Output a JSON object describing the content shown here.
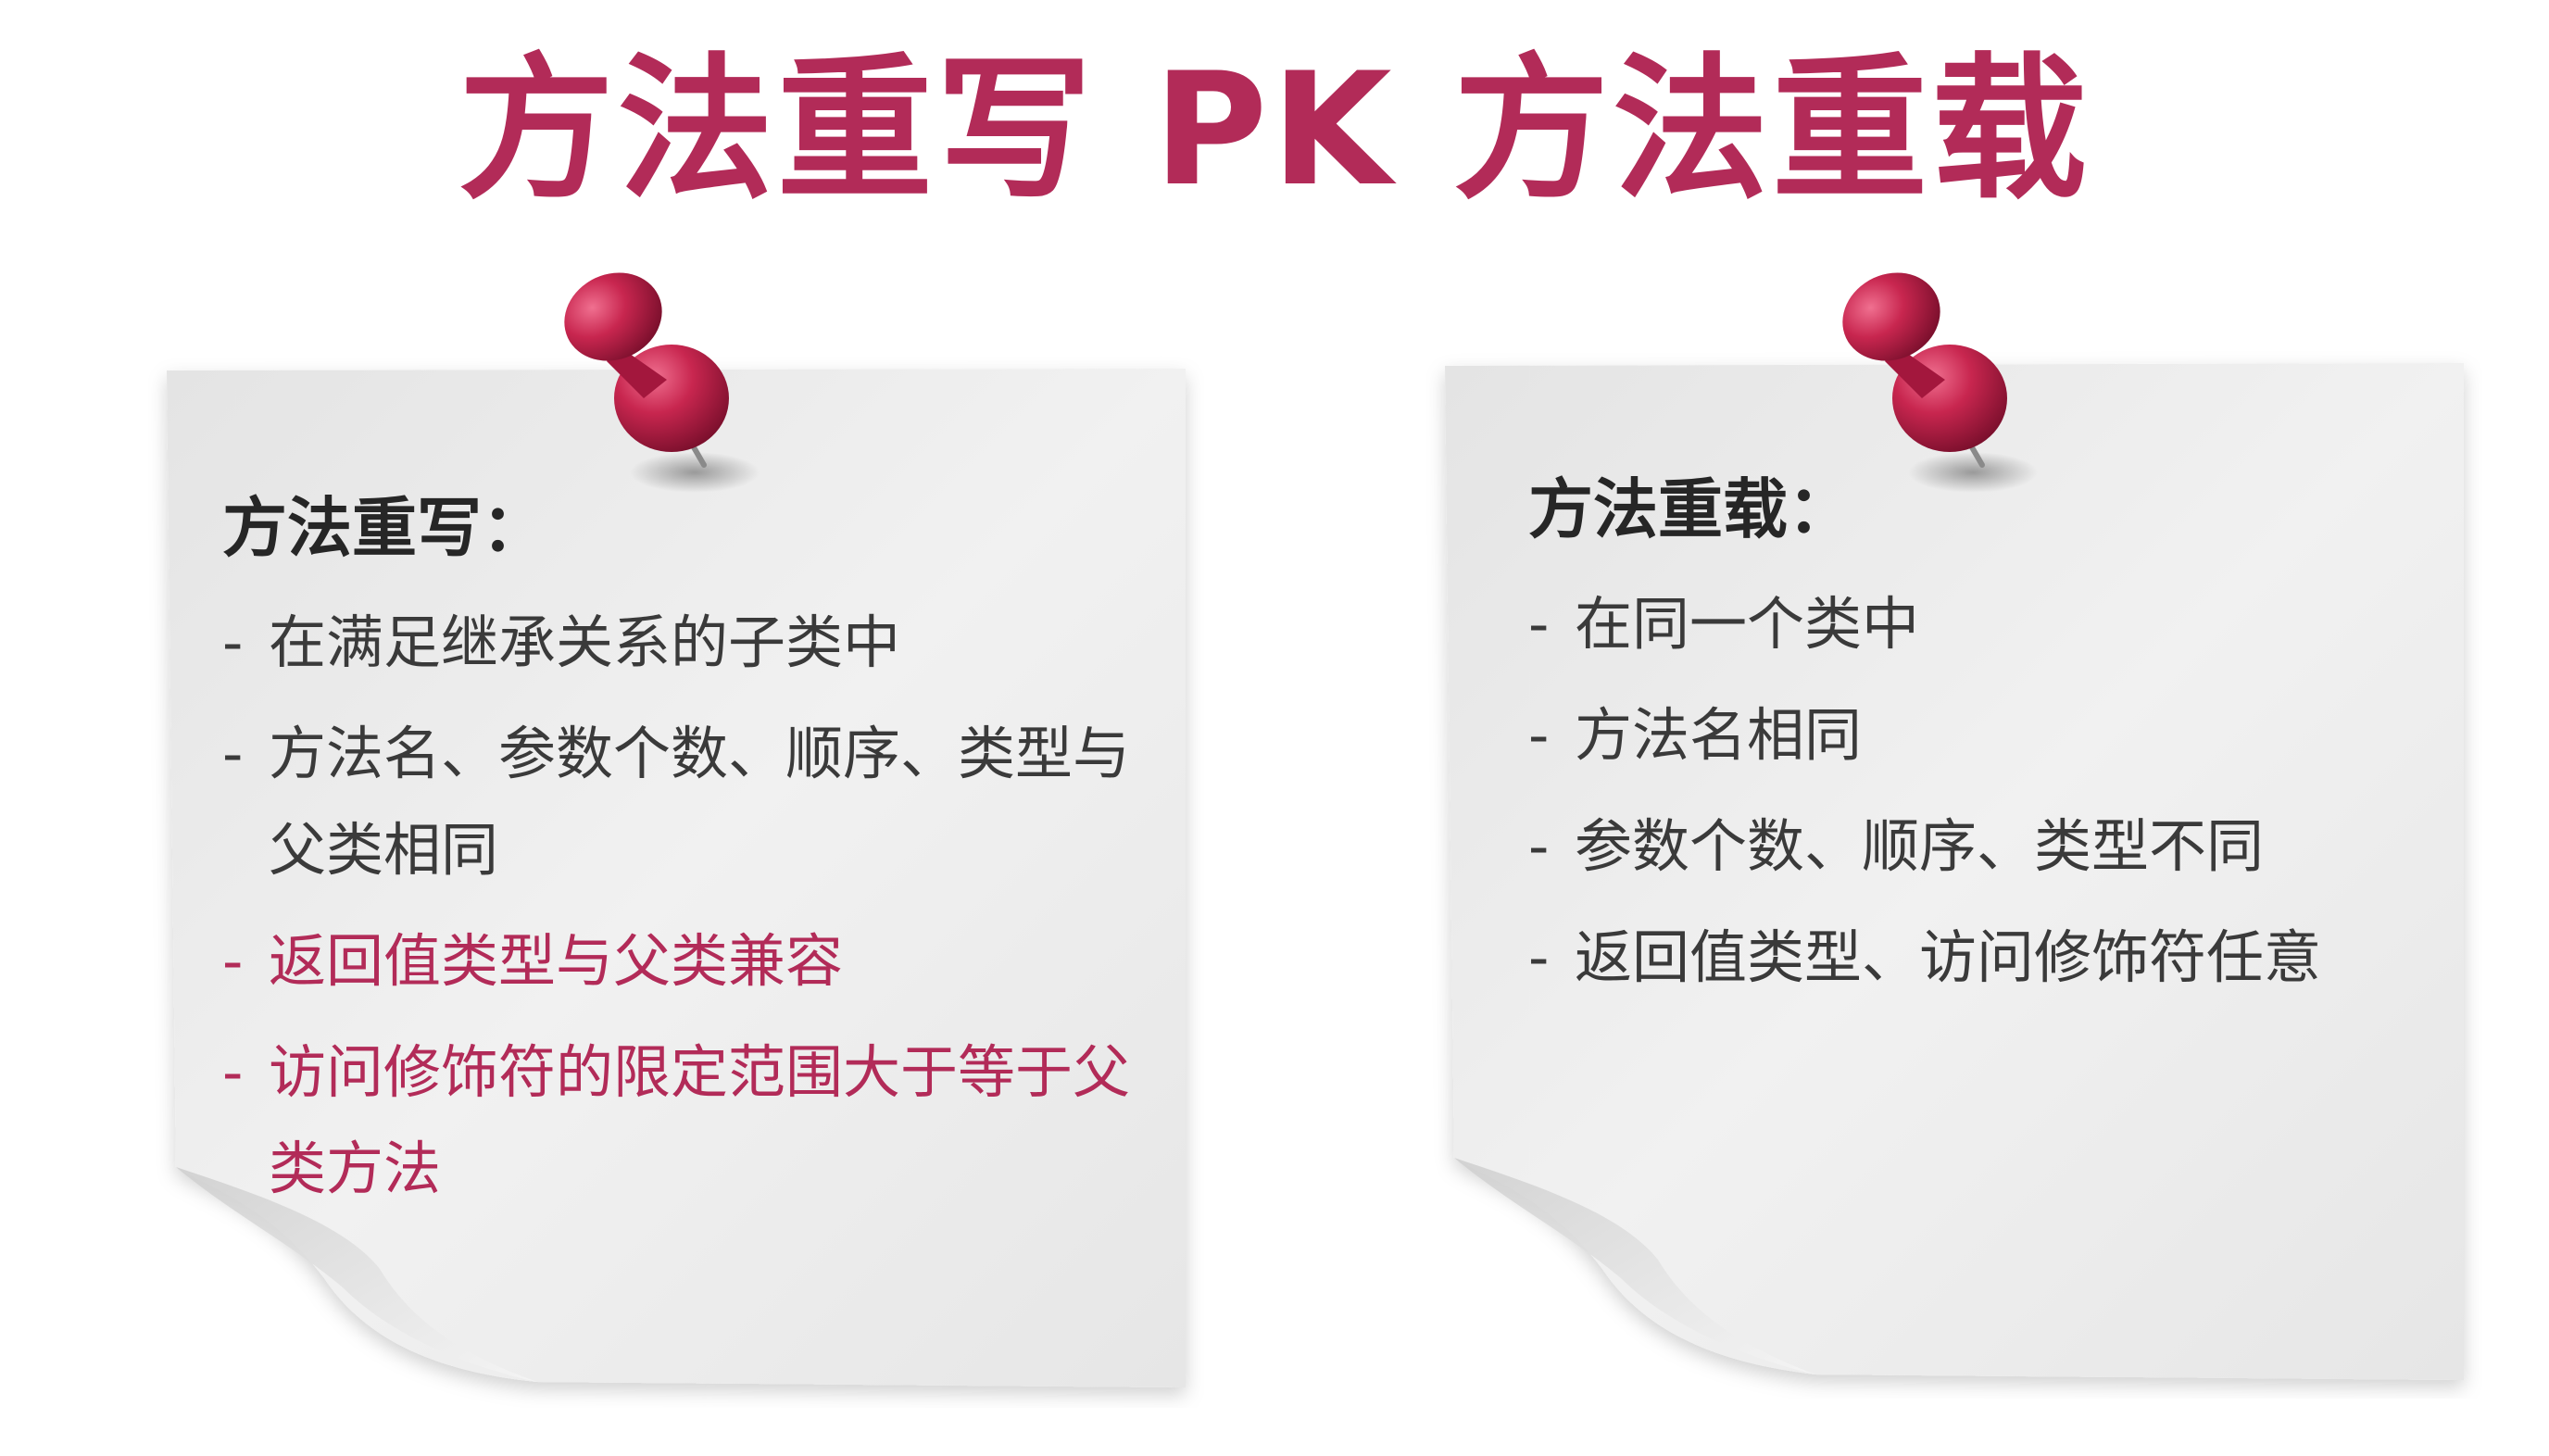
{
  "title": "方法重写   PK 方法重载",
  "accent_color": "#b22b58",
  "text_color": "#3a3a3a",
  "cards": [
    {
      "heading": "方法重写：",
      "items": [
        {
          "dash": "-",
          "text": "在满足继承关系的子类中",
          "highlight": false
        },
        {
          "dash": "-",
          "text": "方法名、参数个数、顺序、类型与父类相同",
          "highlight": false
        },
        {
          "dash": "-",
          "text": "返回值类型与父类兼容",
          "highlight": true
        },
        {
          "dash": "-",
          "text": "访问修饰符的限定范围大于等于父类方法",
          "highlight": true
        }
      ]
    },
    {
      "heading": "方法重载：",
      "items": [
        {
          "dash": "-",
          "text": "在同一个类中",
          "highlight": false
        },
        {
          "dash": "-",
          "text": "方法名相同",
          "highlight": false
        },
        {
          "dash": "-",
          "text": "参数个数、顺序、类型不同",
          "highlight": false
        },
        {
          "dash": "-",
          "text": "返回值类型、访问修饰符任意",
          "highlight": false
        }
      ]
    }
  ],
  "icons": [
    "pushpin-icon",
    "pushpin-icon"
  ]
}
